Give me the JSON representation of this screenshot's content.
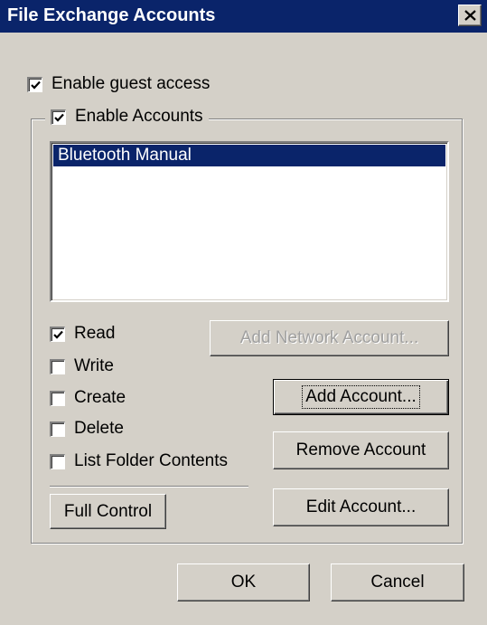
{
  "window": {
    "title": "File Exchange Accounts",
    "close_icon": "close-icon"
  },
  "guest": {
    "label": "Enable guest access",
    "checked": true
  },
  "accounts_group": {
    "label": "Enable Accounts",
    "checked": true
  },
  "accounts_list": {
    "items": [
      {
        "name": "Bluetooth Manual",
        "selected": true
      }
    ]
  },
  "permissions": [
    {
      "label": "Read",
      "checked": true
    },
    {
      "label": "Write",
      "checked": false
    },
    {
      "label": "Create",
      "checked": false
    },
    {
      "label": "Delete",
      "checked": false
    },
    {
      "label": "List Folder Contents",
      "checked": false
    }
  ],
  "buttons": {
    "full_control": "Full Control",
    "add_network_account": "Add Network Account...",
    "add_account": "Add Account...",
    "remove_account": "Remove Account",
    "edit_account": "Edit Account...",
    "ok": "OK",
    "cancel": "Cancel"
  },
  "colors": {
    "face": "#d4d0c8",
    "title_bar": "#0a246a",
    "selection": "#0a246a"
  }
}
